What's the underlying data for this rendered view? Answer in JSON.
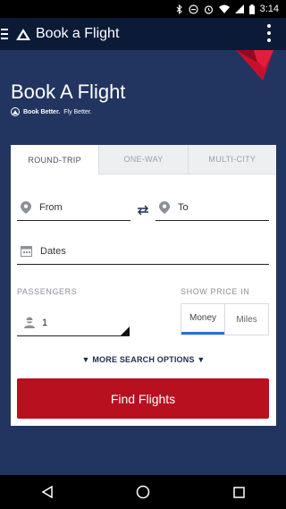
{
  "status_bar": {
    "time": "3:14",
    "icons": [
      "bluetooth-icon",
      "minus-circle-icon",
      "alarm-icon",
      "wifi-icon",
      "signal-icon",
      "battery-icon"
    ]
  },
  "app_bar": {
    "title": "Book a Flight",
    "icons": [
      "menu-icon",
      "delta-logo-icon",
      "overflow-menu-icon"
    ]
  },
  "hero": {
    "heading": "Book A Flight",
    "tagline_bold": "Book Better.",
    "tagline_rest": "Fly Better."
  },
  "trip_tabs": [
    {
      "label": "ROUND-TRIP",
      "active": true
    },
    {
      "label": "ONE-WAY",
      "active": false
    },
    {
      "label": "MULTI-CITY",
      "active": false
    }
  ],
  "form": {
    "from_label": "From",
    "to_label": "To",
    "dates_label": "Dates",
    "passengers_label": "PASSENGERS",
    "passengers_value": "1",
    "show_price_label": "SHOW PRICE IN",
    "price_options": [
      "Money",
      "Miles"
    ],
    "price_selected": "Money",
    "more_options_label": "MORE SEARCH OPTIONS",
    "find_button_label": "Find Flights"
  },
  "colors": {
    "brand_navy": "#223560",
    "appbar": "#0b1a36",
    "accent_red": "#b8101f",
    "toggle_underline": "#2a6fd6"
  },
  "nav_bar": {
    "icons": [
      "back-icon",
      "home-icon",
      "recents-icon"
    ]
  }
}
